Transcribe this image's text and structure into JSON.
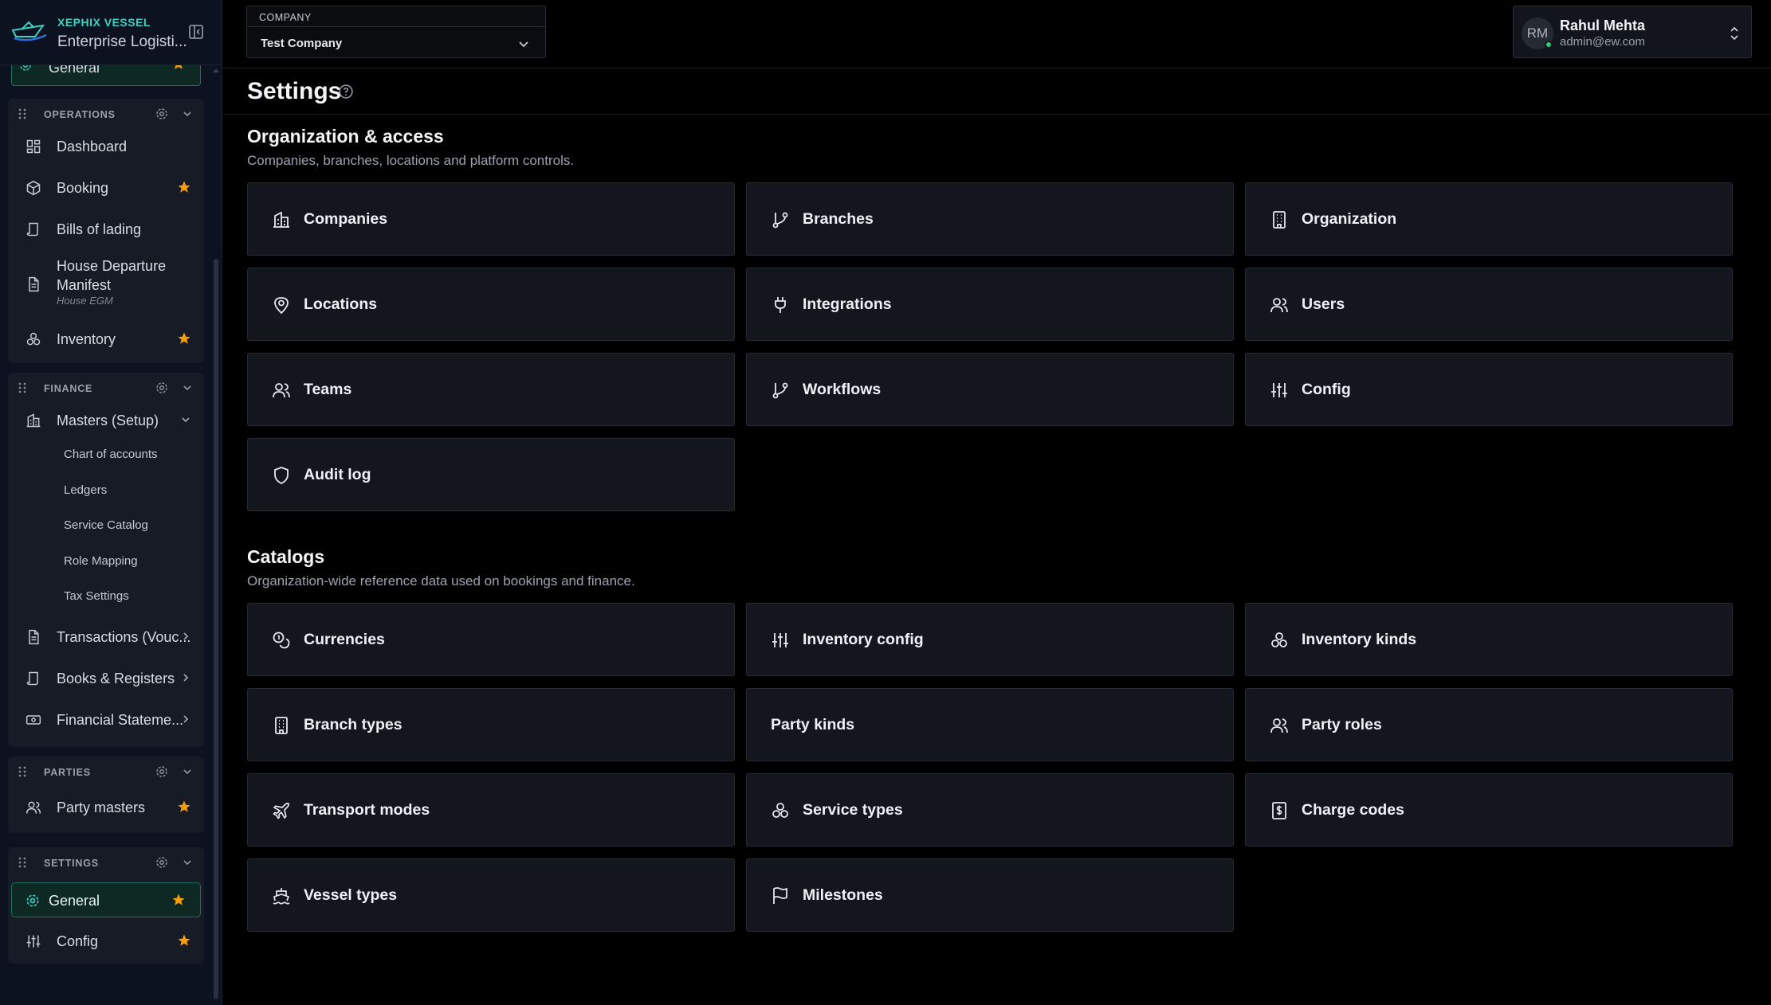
{
  "brand": {
    "name": "XEPHIX VESSEL",
    "subtitle": "Enterprise Logisti..."
  },
  "sidebar": {
    "top_stub_label": "General",
    "groups": {
      "operations": {
        "label": "OPERATIONS",
        "items": {
          "dashboard": "Dashboard",
          "booking": "Booking",
          "bills": "Bills of lading",
          "hdm": "House Departure Manifest",
          "hdm_sub": "House EGM",
          "inventory": "Inventory"
        }
      },
      "finance": {
        "label": "FINANCE",
        "items": {
          "masters": "Masters (Setup)",
          "chart": "Chart of accounts",
          "ledgers": "Ledgers",
          "service_catalog": "Service Catalog",
          "role_mapping": "Role Mapping",
          "tax_settings": "Tax Settings",
          "transactions": "Transactions (Vouc...",
          "books": "Books & Registers",
          "financial": "Financial Stateme..."
        }
      },
      "parties": {
        "label": "PARTIES",
        "items": {
          "party_masters": "Party masters"
        }
      },
      "settings": {
        "label": "SETTINGS",
        "items": {
          "general": "General",
          "config": "Config"
        }
      }
    }
  },
  "header": {
    "company_label": "COMPANY",
    "company_value": "Test Company",
    "user_initials": "RM",
    "user_name": "Rahul Mehta",
    "user_email": "admin@ew.com"
  },
  "page": {
    "title": "Settings"
  },
  "org_section": {
    "title": "Organization & access",
    "description": "Companies, branches, locations and platform controls.",
    "cards": {
      "companies": "Companies",
      "branches": "Branches",
      "organization": "Organization",
      "locations": "Locations",
      "integrations": "Integrations",
      "users": "Users",
      "teams": "Teams",
      "workflows": "Workflows",
      "config": "Config",
      "audit_log": "Audit log"
    }
  },
  "catalogs_section": {
    "title": "Catalogs",
    "description": "Organization-wide reference data used on bookings and finance.",
    "cards": {
      "currencies": "Currencies",
      "inventory_config": "Inventory config",
      "inventory_kinds": "Inventory kinds",
      "branch_types": "Branch types",
      "party_kinds": "Party kinds",
      "party_roles": "Party roles",
      "transport_modes": "Transport modes",
      "service_types": "Service types",
      "charge_codes": "Charge codes",
      "vessel_types": "Vessel types",
      "milestones": "Milestones"
    }
  },
  "colors": {
    "accent": "#3dd1c4",
    "star": "#f59e0b",
    "active_bg": "#0e2824",
    "active_border": "#1f6f5f",
    "online": "#2ecc71"
  }
}
